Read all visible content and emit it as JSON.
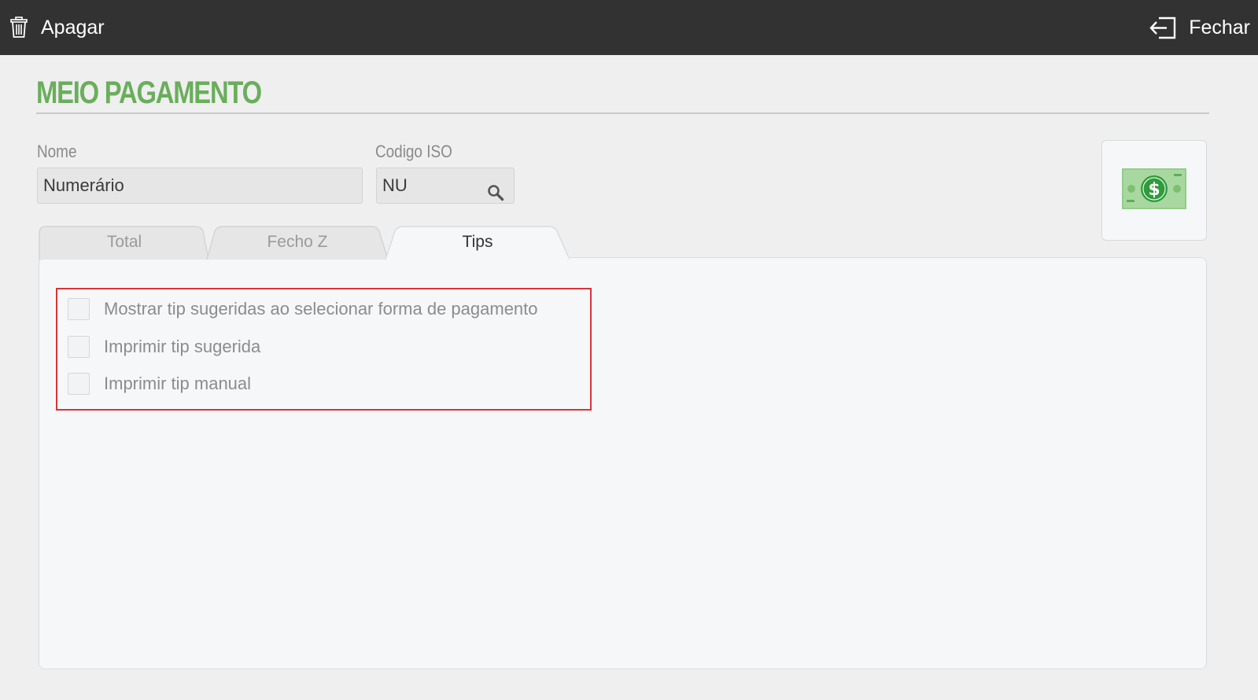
{
  "toolbar": {
    "delete_label": "Apagar",
    "close_label": "Fechar",
    "delete_icon": "trash-icon",
    "close_icon": "exit-icon"
  },
  "page": {
    "title": "MEIO PAGAMENTO"
  },
  "form": {
    "name_label": "Nome",
    "name_value": "Numerário",
    "iso_label": "Codigo ISO",
    "iso_value": "NU",
    "iso_icon": "search-icon",
    "image_icon": "dollar-bill-icon"
  },
  "tabs": [
    {
      "label": "Total",
      "active": false
    },
    {
      "label": "Fecho Z",
      "active": false
    },
    {
      "label": "Tips",
      "active": true
    }
  ],
  "tips": {
    "options": [
      {
        "label": "Mostrar tip sugeridas ao selecionar forma de pagamento",
        "checked": false
      },
      {
        "label": "Imprimir tip sugerida",
        "checked": false
      },
      {
        "label": "Imprimir tip manual",
        "checked": false
      }
    ]
  },
  "colors": {
    "topbar": "#323232",
    "title_green": "#6aae5c",
    "highlight_red": "#d9343a",
    "panel_bg": "#f6f7f9"
  }
}
